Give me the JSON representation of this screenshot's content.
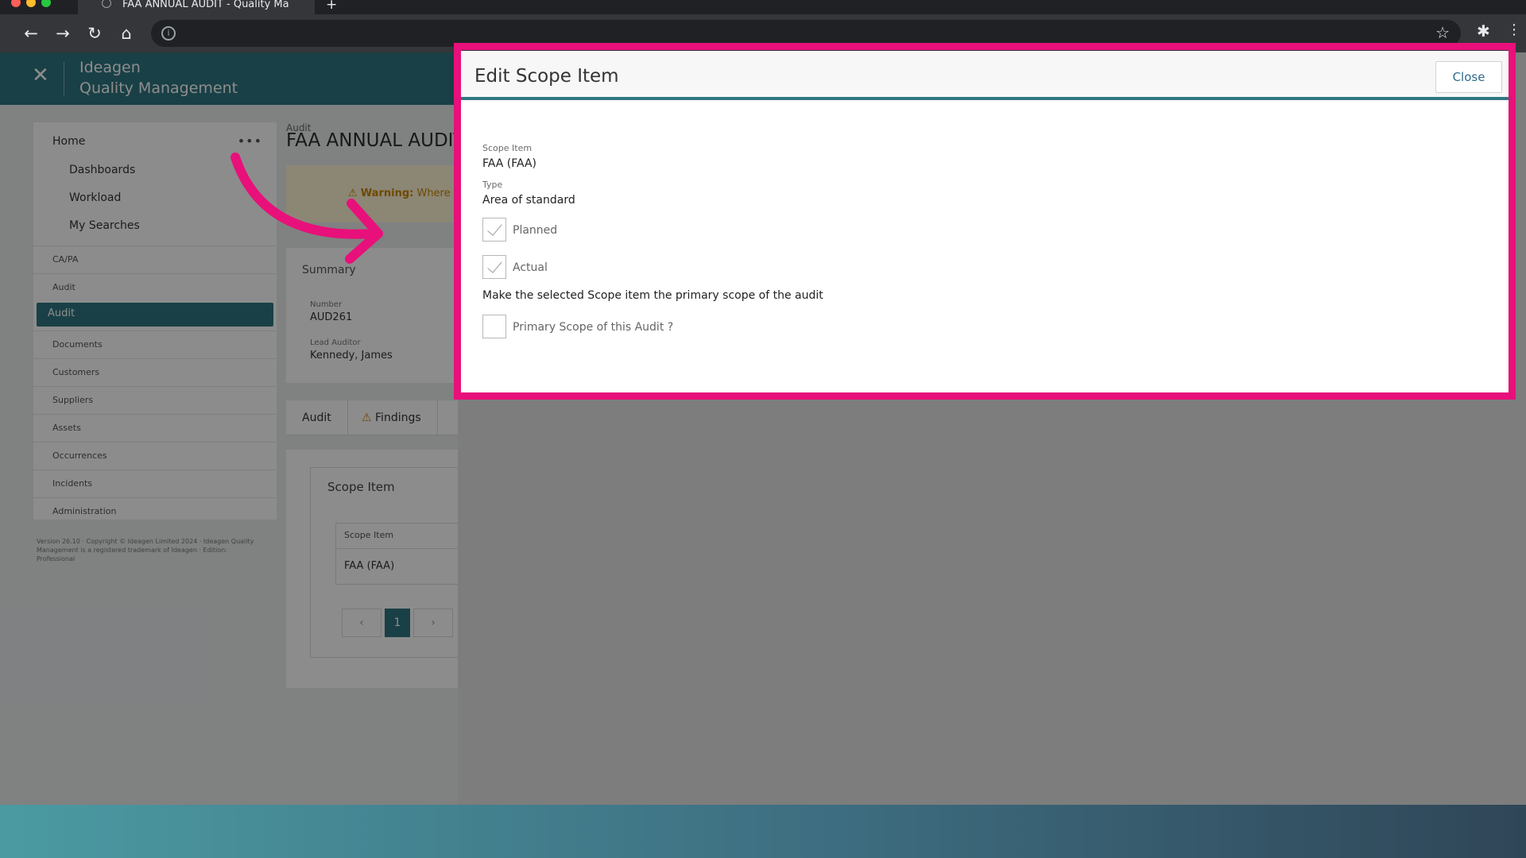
{
  "browser": {
    "tab_title": "FAA ANNUAL AUDIT - Quality Ma",
    "new_tab": "+",
    "window_dot_colors": [
      "#ff5f57",
      "#febc2e",
      "#28c840"
    ]
  },
  "app": {
    "logo_line1": "Ideagen",
    "logo_line2": "Quality Management",
    "close_symbol": "✕"
  },
  "sidebar": {
    "home": "Home",
    "more": "•••",
    "sub_items": [
      "Dashboards",
      "Workload",
      "My Searches"
    ],
    "items": [
      "CA/PA",
      "Audit",
      "Audit",
      "Documents",
      "Customers",
      "Suppliers",
      "Assets",
      "Occurrences",
      "Incidents",
      "Administration"
    ],
    "active_index": 2,
    "footer": "Version 26.10 · Copyright © Ideagen Limited 2024 · Ideagen Quality Management is a registered trademark of Ideagen · Edition: Professional"
  },
  "main": {
    "breadcrumb": "Audit",
    "title": "FAA ANNUAL AUDIT",
    "warning_bold": "Warning:",
    "warning_rest": " Where",
    "summary_title": "Summary",
    "number_label": "Number",
    "number_value": "AUD261",
    "auditor_label": "Lead Auditor",
    "auditor_value": "Kennedy, James",
    "tabs": [
      "Audit",
      "Findings"
    ],
    "scope_title": "Scope Item",
    "scope_col": "Scope Item",
    "scope_row": "FAA (FAA)",
    "page_prev": "‹",
    "page_current": "1",
    "page_next": "›"
  },
  "dialog": {
    "title": "Edit Scope Item",
    "close_label": "Close",
    "scope_item_label": "Scope Item",
    "scope_item_value": "FAA (FAA)",
    "type_label": "Type",
    "type_value": "Area of standard",
    "planned_label": "Planned",
    "planned_checked": true,
    "actual_label": "Actual",
    "actual_checked": true,
    "primary_note": "Make the selected Scope item the primary scope of the audit",
    "primary_label": "Primary Scope of this Audit ?",
    "primary_checked": false
  },
  "colors": {
    "highlight": "#e8107a",
    "accent": "#2f7680",
    "close_text": "#2f6c89"
  }
}
